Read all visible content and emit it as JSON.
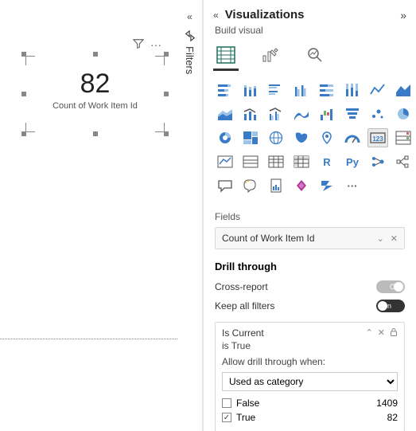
{
  "canvas": {
    "value": "82",
    "label": "Count of Work Item Id"
  },
  "filters_tab": {
    "label": "Filters"
  },
  "pane": {
    "title": "Visualizations",
    "subtitle": "Build visual",
    "tool_tabs": [
      "build-visual-icon",
      "format-icon",
      "analytics-icon"
    ],
    "selected_visual": "card",
    "fields_label": "Fields",
    "field_well": "Count of Work Item Id",
    "drill_through": {
      "heading": "Drill through",
      "cross_report_label": "Cross-report",
      "cross_report_on": false,
      "keep_filters_label": "Keep all filters",
      "keep_filters_on": true,
      "filter": {
        "name": "Is Current",
        "summary": "is True",
        "allow_label": "Allow drill through when:",
        "mode": "Used as category",
        "values": [
          {
            "label": "False",
            "count": "1409",
            "checked": false
          },
          {
            "label": "True",
            "count": "82",
            "checked": true
          }
        ]
      }
    },
    "toggle_text": {
      "on": "On",
      "off": "Off"
    }
  },
  "icons": {
    "R": "R",
    "Py": "Py",
    "ellipsis": "···",
    "collapse_l": "«",
    "expand_r": "»",
    "filter": "▽",
    "chev_down": "⌄",
    "close": "✕",
    "lock": "🔒",
    "up": "⌃"
  },
  "colors": {
    "accent": "#3a7bc8"
  }
}
